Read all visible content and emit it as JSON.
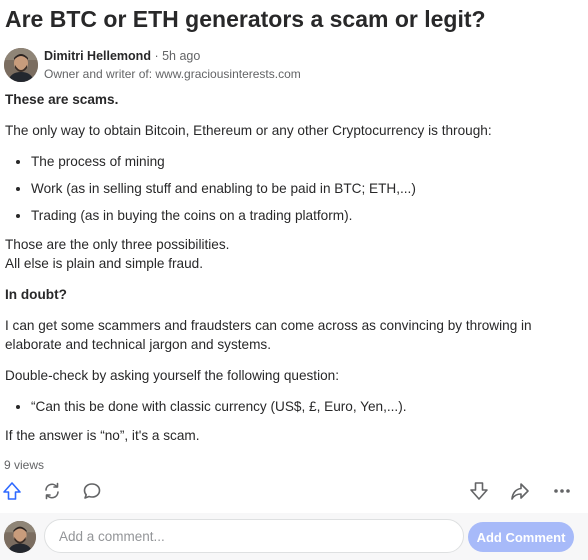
{
  "question": {
    "title": "Are BTC or ETH generators a scam or legit?"
  },
  "author": {
    "name": "Dimitri Hellemond",
    "separator": " · ",
    "time": "5h ago",
    "credential": "Owner and writer of: www.graciousinterests.com"
  },
  "answer": {
    "p1": "These are scams.",
    "p2": "The only way to obtain Bitcoin, Ethereum or any other Cryptocurrency is through:",
    "list1": [
      "The process of mining",
      "Work (as in selling stuff and enabling to be paid in BTC; ETH,...)",
      "Trading (as in buying the coins on a trading platform)."
    ],
    "p3_line1": "Those are the only three possibilities.",
    "p3_line2": "All else is plain and simple fraud.",
    "p4": "In doubt?",
    "p5": "I can get some scammers and fraudsters can come across as convincing by throwing in elaborate and technical jargon and systems.",
    "p6": "Double-check by asking yourself the following question:",
    "list2": [
      "“Can this be done with classic currency (US$, £, Euro, Yen,...)."
    ],
    "p7": "If the answer is “no”, it's a scam."
  },
  "stats": {
    "views": "9 views"
  },
  "actions": {
    "upvote_icon": "arrow-up-outline-icon",
    "share_icon": "refresh-icon",
    "comment_icon": "speech-bubble-icon",
    "downvote_icon": "arrow-down-outline-icon",
    "forward_icon": "arrow-forward-icon",
    "more_icon": "ellipsis-icon",
    "upvote_color": "#2e69ff"
  },
  "comment_box": {
    "placeholder": "Add a comment...",
    "button_label": "Add Comment",
    "button_color": "#a7baf9"
  }
}
